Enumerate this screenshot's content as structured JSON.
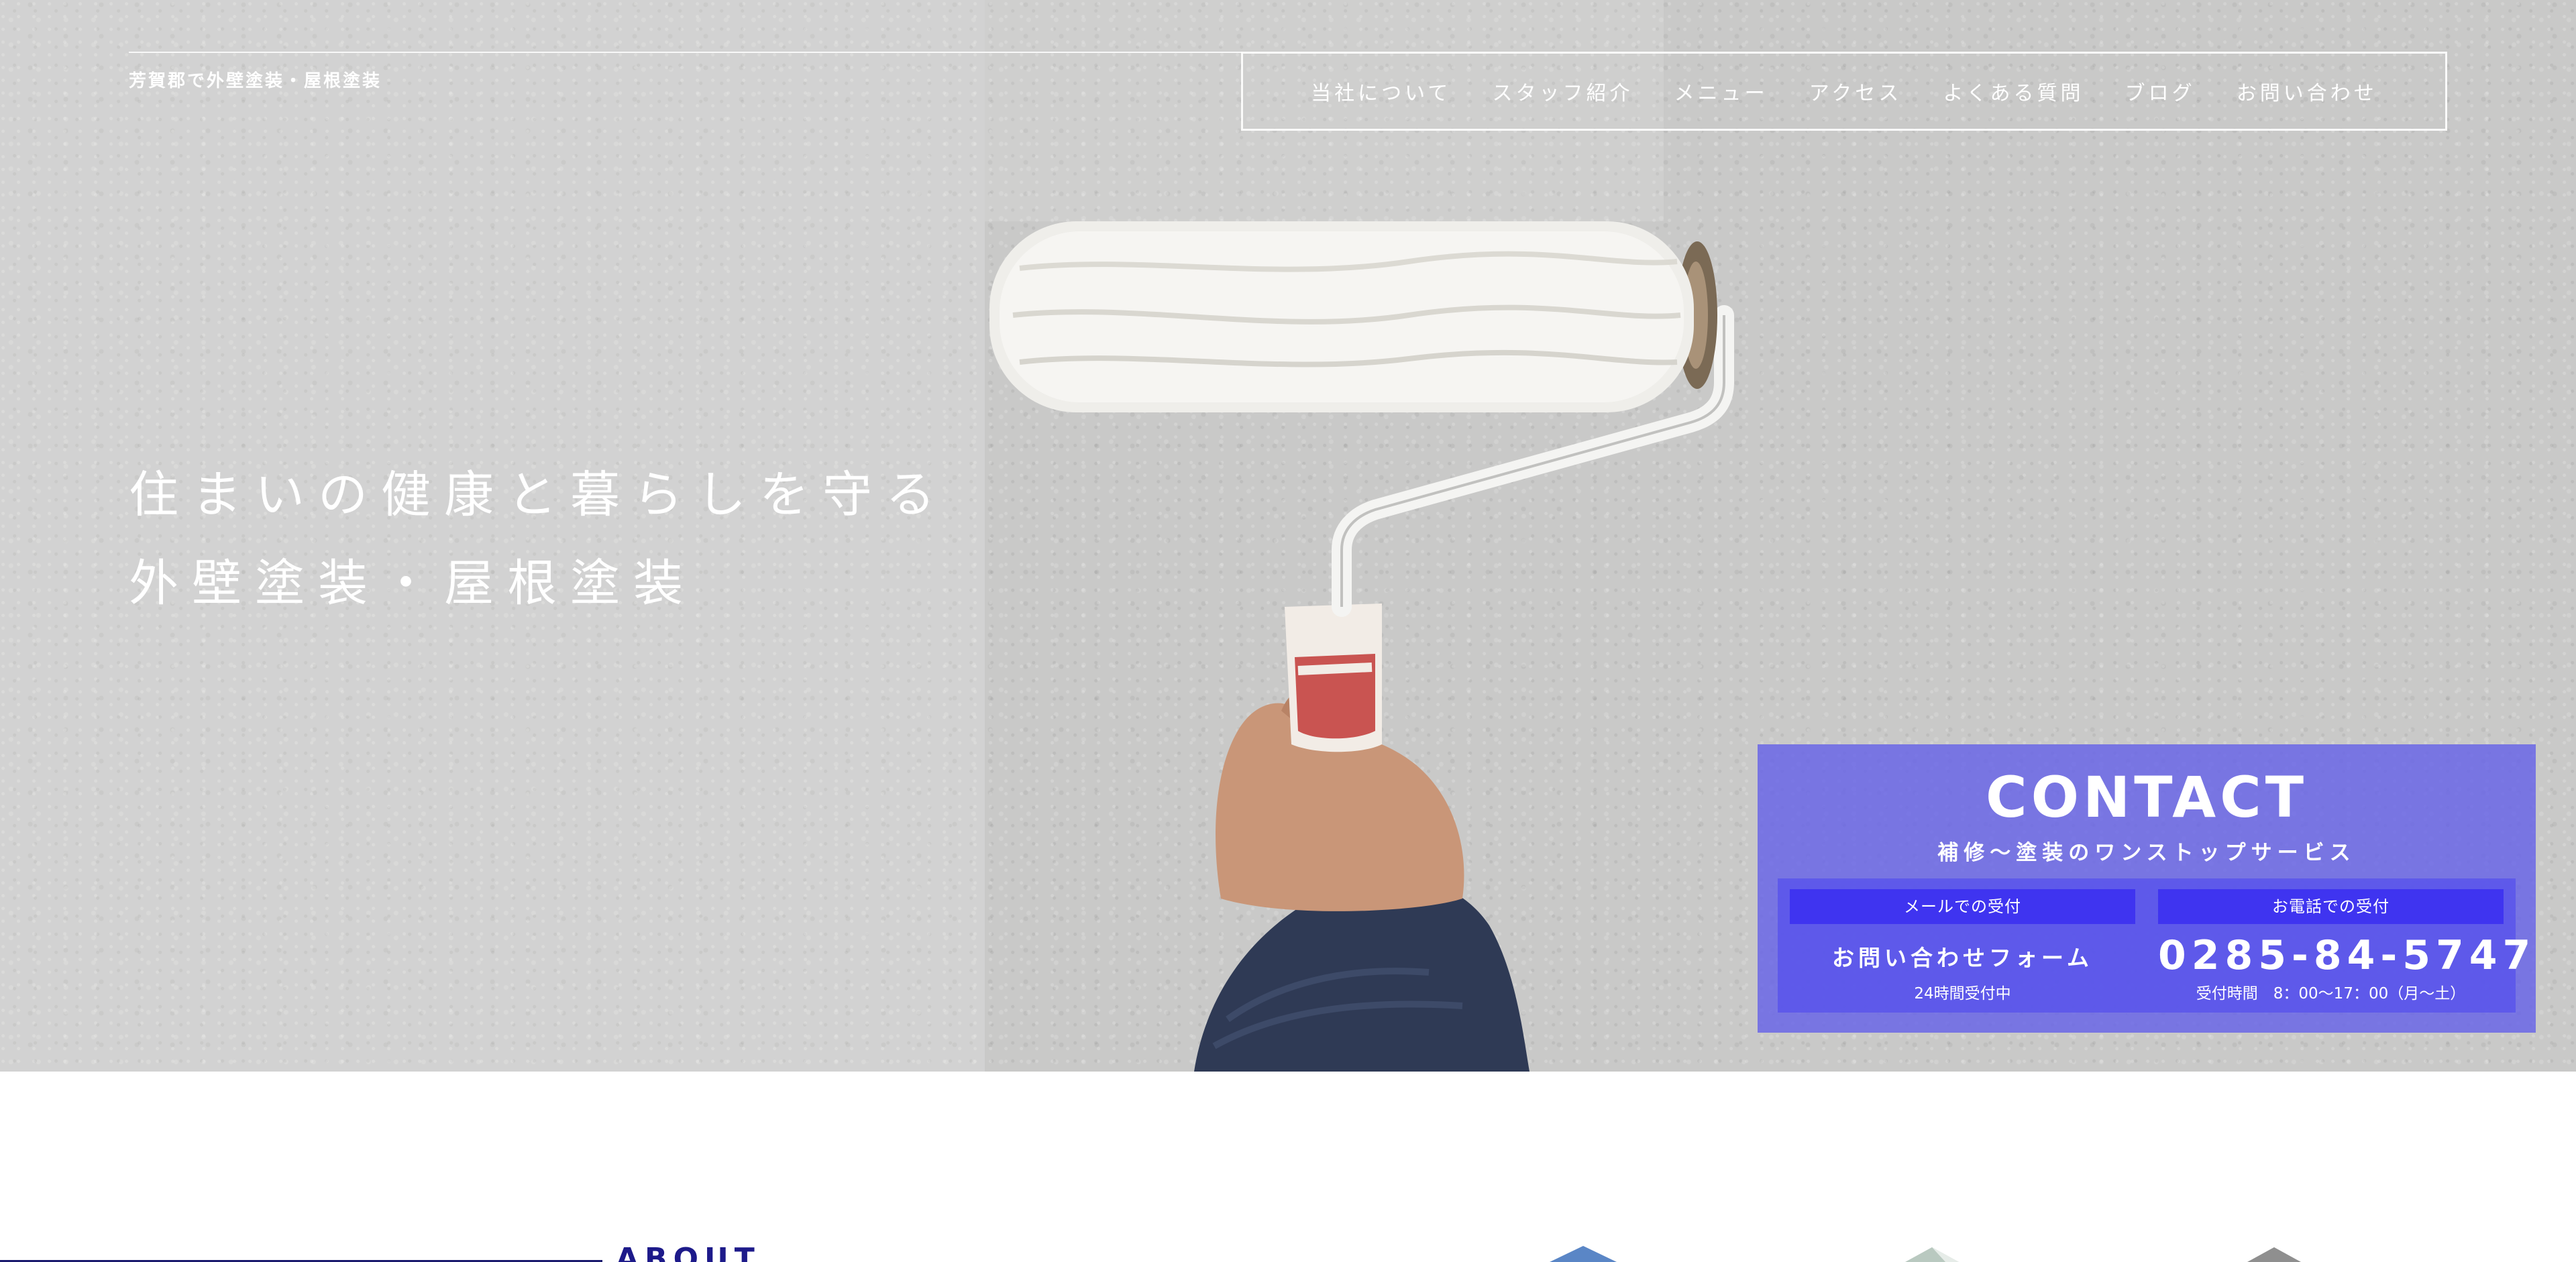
{
  "header": {
    "tagline": "芳賀郡で外壁塗装・屋根塗装",
    "nav": [
      {
        "label": "当社について"
      },
      {
        "label": "スタッフ紹介"
      },
      {
        "label": "メニュー"
      },
      {
        "label": "アクセス"
      },
      {
        "label": "よくある質問"
      },
      {
        "label": "ブログ"
      },
      {
        "label": "お問い合わせ"
      }
    ]
  },
  "hero": {
    "line1": "住まいの健康と暮らしを守る",
    "line2": "外壁塗装・屋根塗装"
  },
  "contact": {
    "title": "CONTACT",
    "subtitle": "補修～塗装のワンストップサービス",
    "mail": {
      "label": "メールでの受付",
      "main": "お問い合わせフォーム",
      "note": "24時間受付中"
    },
    "phone": {
      "label": "お電話での受付",
      "number": "0285-84-5747",
      "hours": "受付時間　8：00～17：00（月～土）"
    }
  },
  "about": {
    "title": "ABOUT"
  },
  "colors": {
    "panel": "#6460e8",
    "label": "#3f34f0",
    "about": "#1d1a8a"
  }
}
